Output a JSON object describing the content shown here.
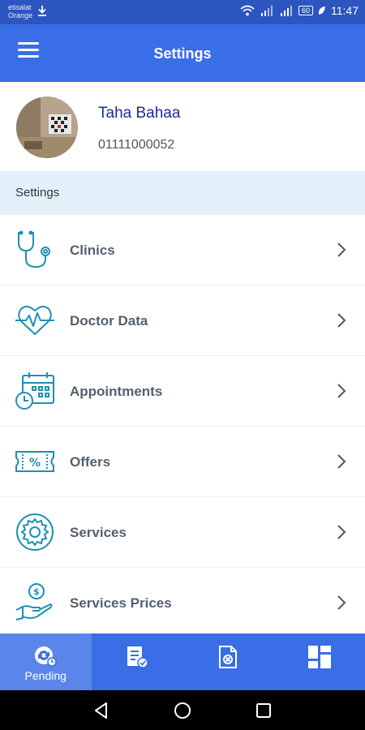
{
  "status_bar": {
    "carrier_line1": "etisalat",
    "carrier_line2": "Orange",
    "battery": "60",
    "time": "11:47"
  },
  "app_bar": {
    "title": "Settings",
    "menu_icon": "hamburger-menu-icon"
  },
  "profile": {
    "name": "Taha Bahaa",
    "phone": "01111000052"
  },
  "section_header": "Settings",
  "settings_items": [
    {
      "label": "Clinics",
      "icon": "stethoscope-icon"
    },
    {
      "label": "Doctor Data",
      "icon": "heartbeat-icon"
    },
    {
      "label": "Appointments",
      "icon": "calendar-clock-icon"
    },
    {
      "label": "Offers",
      "icon": "discount-ticket-icon"
    },
    {
      "label": "Services",
      "icon": "gear-icon"
    },
    {
      "label": "Services Prices",
      "icon": "hand-money-icon"
    }
  ],
  "tab_bar": {
    "tabs": [
      {
        "label": "Pending",
        "icon": "pending-icon",
        "active": true
      },
      {
        "label": "",
        "icon": "accepted-document-icon",
        "active": false
      },
      {
        "label": "",
        "icon": "cancelled-document-icon",
        "active": false
      },
      {
        "label": "",
        "icon": "dashboard-grid-icon",
        "active": false
      }
    ]
  },
  "colors": {
    "status_bar": "#2c55c0",
    "app_bar": "#3a6ee6",
    "section_header_bg": "#e3f1fb",
    "icon_teal": "#1f8fb4",
    "name_color": "#1d2a9e"
  }
}
